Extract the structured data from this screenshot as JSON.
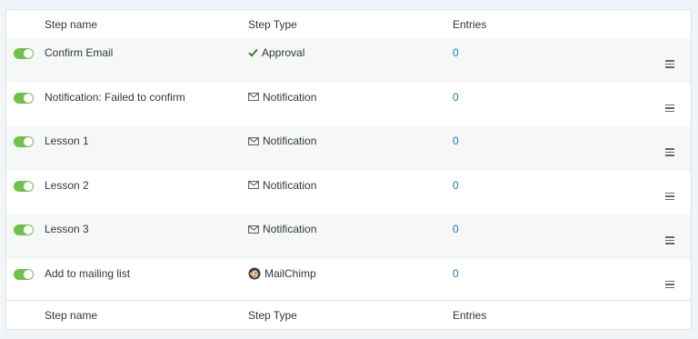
{
  "table": {
    "headers": {
      "name": "Step name",
      "type": "Step Type",
      "entries": "Entries"
    },
    "footers": {
      "name": "Step name",
      "type": "Step Type",
      "entries": "Entries"
    },
    "rows": [
      {
        "name": "Confirm Email",
        "type": "Approval",
        "type_icon": "checkmark-icon",
        "entries": "0",
        "enabled": true
      },
      {
        "name": "Notification: Failed to confirm",
        "type": "Notification",
        "type_icon": "envelope-icon",
        "entries": "0",
        "enabled": true
      },
      {
        "name": "Lesson 1",
        "type": "Notification",
        "type_icon": "envelope-icon",
        "entries": "0",
        "enabled": true
      },
      {
        "name": "Lesson 2",
        "type": "Notification",
        "type_icon": "envelope-icon",
        "entries": "0",
        "enabled": true
      },
      {
        "name": "Lesson 3",
        "type": "Notification",
        "type_icon": "envelope-icon",
        "entries": "0",
        "enabled": true
      },
      {
        "name": "Add to mailing list",
        "type": "MailChimp",
        "type_icon": "mailchimp-icon",
        "entries": "0",
        "enabled": true
      }
    ]
  },
  "colors": {
    "toggle_on": "#6ec24a",
    "link": "#1e7ab8",
    "approval_check": "#2e8b1e"
  }
}
